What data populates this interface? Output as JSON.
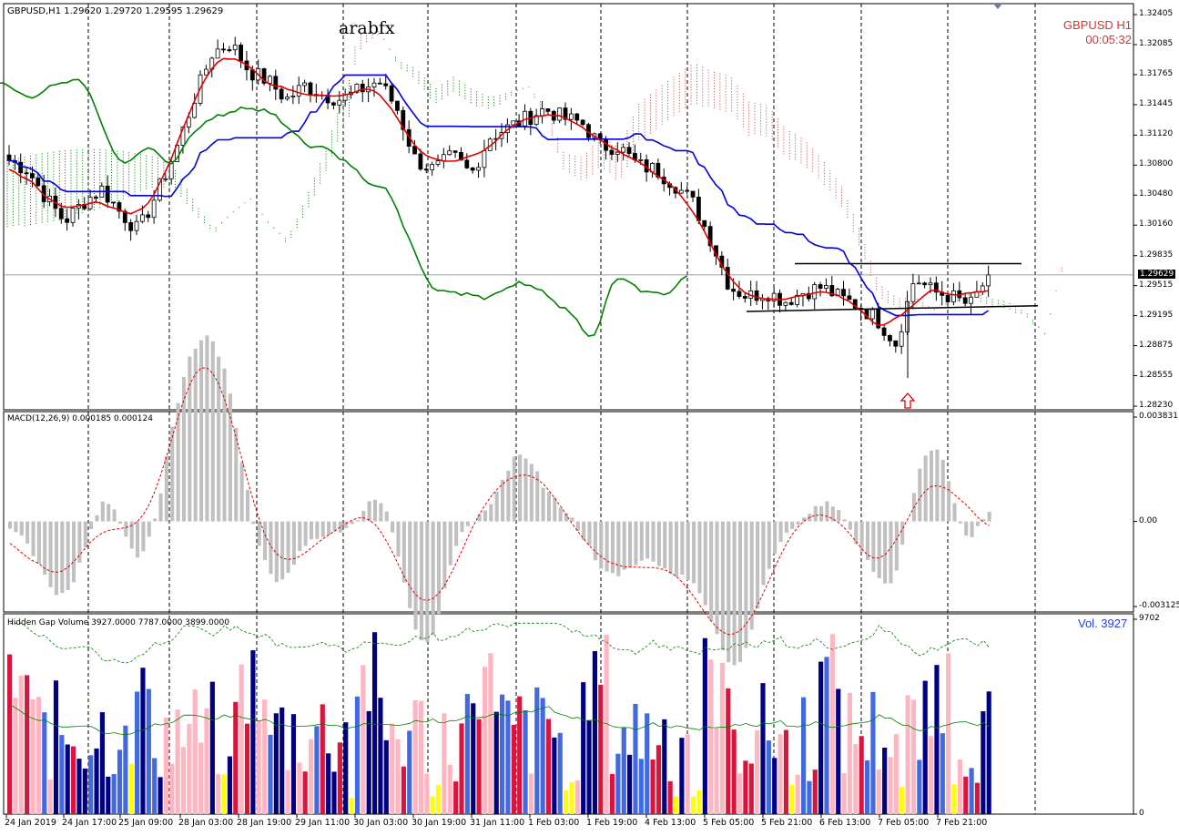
{
  "main": {
    "header": "GBPUSD,H1  1.29620 1.29720 1.29595 1.29629",
    "watermark": "arabfx",
    "symbol_label": "GBPUSD  H1",
    "timer": "00:05:32",
    "current_price": "1.29629",
    "price_scale": [
      "1.32405",
      "1.32085",
      "1.31765",
      "1.31445",
      "1.31120",
      "1.30800",
      "1.30480",
      "1.30160",
      "1.29835",
      "1.29515",
      "1.29195",
      "1.28875",
      "1.28555",
      "1.28230"
    ]
  },
  "macd": {
    "header": "MACD(12,26,9) 0.000185 0.000124",
    "scale": [
      "0.003831",
      "0.00",
      "-0.003125"
    ]
  },
  "volume": {
    "header": "Hidden Gap Volume 3927.0000 7787.0000 3899.0000",
    "vol_label": "Vol.  3927",
    "scale": [
      "9702",
      "0"
    ]
  },
  "time_labels": [
    "24 Jan 2019",
    "24 Jan 17:00",
    "25 Jan 09:00",
    "28 Jan 03:00",
    "28 Jan 19:00",
    "29 Jan 11:00",
    "30 Jan 03:00",
    "30 Jan 19:00",
    "31 Jan 11:00",
    "1 Feb 03:00",
    "1 Feb 19:00",
    "4 Feb 13:00",
    "5 Feb 05:00",
    "5 Feb 21:00",
    "6 Feb 13:00",
    "7 Feb 05:00",
    "7 Feb 21:00"
  ],
  "colors": {
    "bull_candle": "#000000",
    "tenkan": "#e00000",
    "kijun": "#0000e0",
    "chikou": "#008000",
    "cloud_bull": "#008000",
    "cloud_bear": "#c0504d",
    "macd_hist": "#c0c0c0",
    "macd_signal": "#e00000",
    "vol_navy": "#000080",
    "vol_red": "#dc143c",
    "vol_blue": "#4169e1",
    "vol_pink": "#ffb6c1",
    "vol_yellow": "#ffff00",
    "arrow": "#e00000"
  },
  "chart_data": {
    "type": "candlestick",
    "symbol": "GBPUSD",
    "timeframe": "H1",
    "ohlc_last": {
      "open": 1.2962,
      "high": 1.2972,
      "low": 1.29595,
      "close": 1.29629
    },
    "y_range": [
      1.2823,
      1.32405
    ],
    "close_path": [
      1.3085,
      1.3075,
      1.3045,
      1.302,
      1.304,
      1.3055,
      1.303,
      1.301,
      1.305,
      1.3095,
      1.315,
      1.32,
      1.321,
      1.318,
      1.317,
      1.315,
      1.3165,
      1.3155,
      1.315,
      1.316,
      1.317,
      1.314,
      1.3085,
      1.3075,
      1.309,
      1.307,
      1.311,
      1.312,
      1.313,
      1.314,
      1.313,
      1.3125,
      1.31,
      1.31,
      1.308,
      1.3075,
      1.306,
      1.304,
      1.3,
      1.295,
      1.294,
      1.2945,
      1.2935,
      1.2945,
      1.295,
      1.2938,
      1.293,
      1.2915,
      1.289,
      1.296,
      1.2945,
      1.294,
      1.293,
      1.2962
    ],
    "macd": {
      "value": 0.000185,
      "signal": 0.000124,
      "range": [
        -0.003125,
        0.003831
      ]
    },
    "volume": {
      "current": 3927,
      "avg_high": 7787,
      "avg_low": 3899,
      "max": 9702
    }
  }
}
